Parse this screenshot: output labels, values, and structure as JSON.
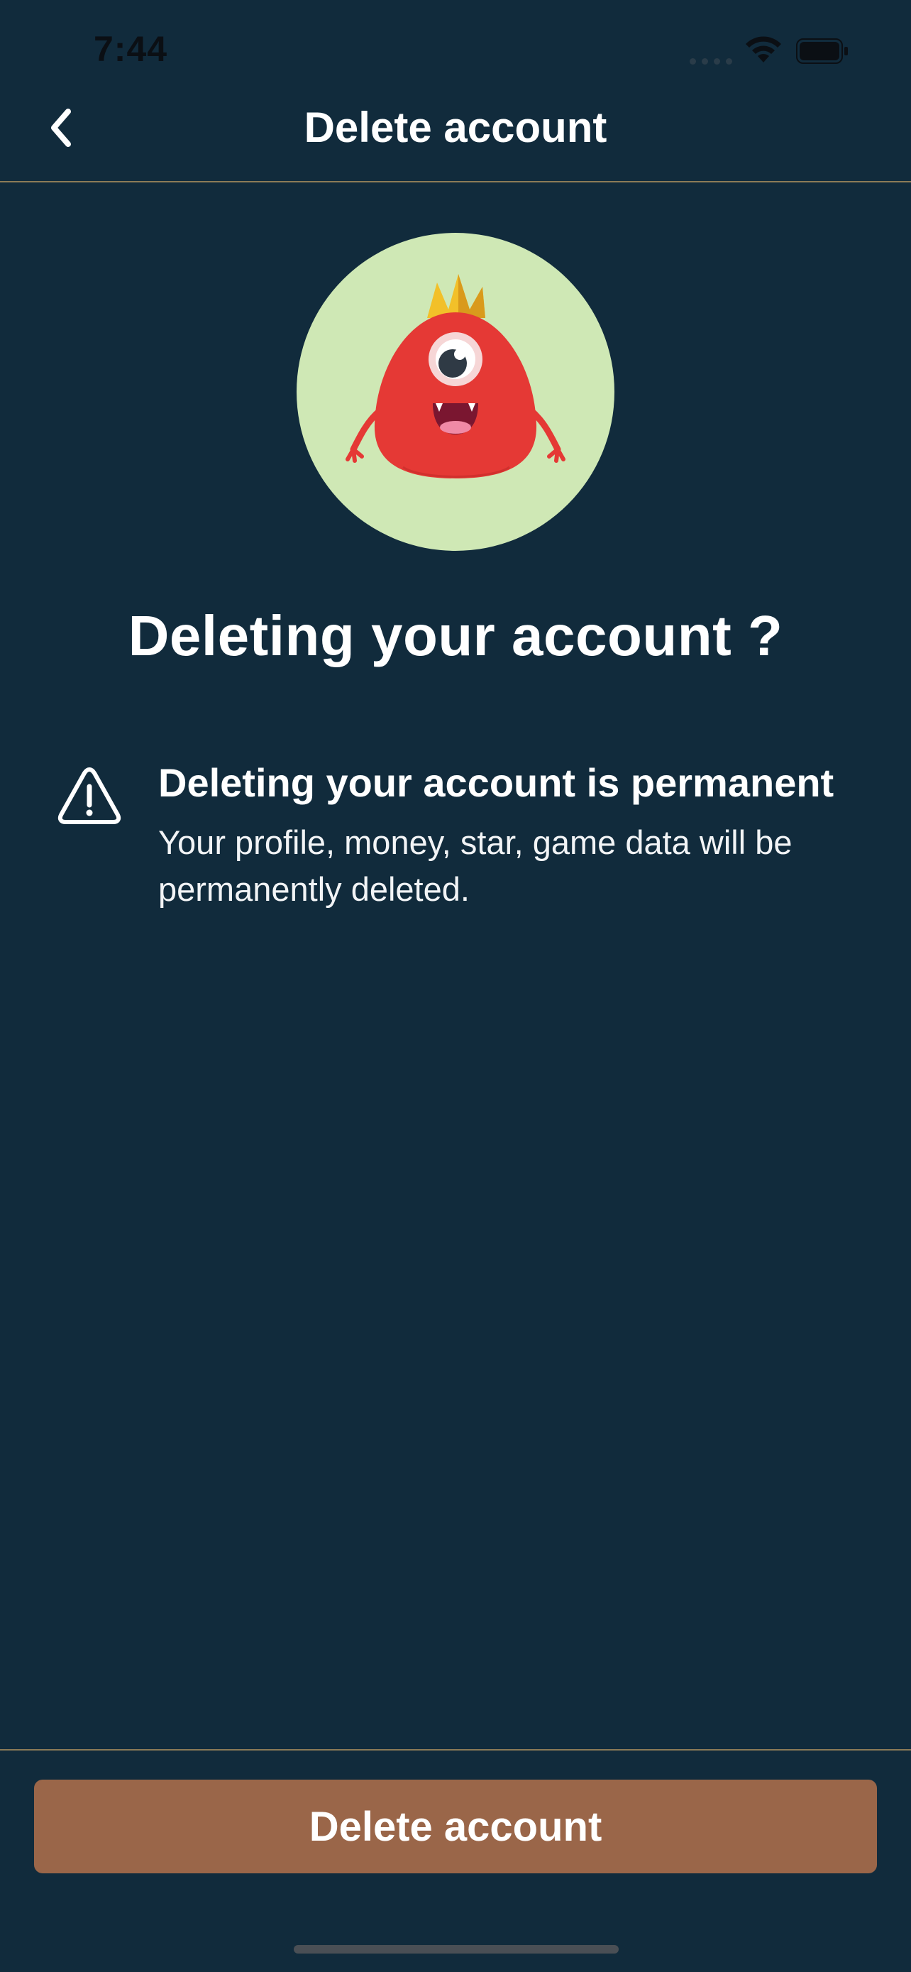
{
  "status_bar": {
    "time": "7:44"
  },
  "header": {
    "title": "Delete account",
    "back_icon": "chevron-left-icon"
  },
  "avatar": {
    "icon": "red-monster-with-crown",
    "colors": {
      "background": "#cfe8b5",
      "body": "#e53935",
      "crown": "#f2c029"
    }
  },
  "main": {
    "headline": "Deleting your account ?",
    "warning": {
      "icon": "warning-triangle-icon",
      "title": "Deleting your account is permanent",
      "body": "Your profile, money, star, game data will be permanently deleted."
    }
  },
  "footer": {
    "delete_label": "Delete account"
  },
  "colors": {
    "background": "#112b3c",
    "divider": "#8c7b57",
    "button": "#9a6649",
    "text": "#ffffff"
  }
}
